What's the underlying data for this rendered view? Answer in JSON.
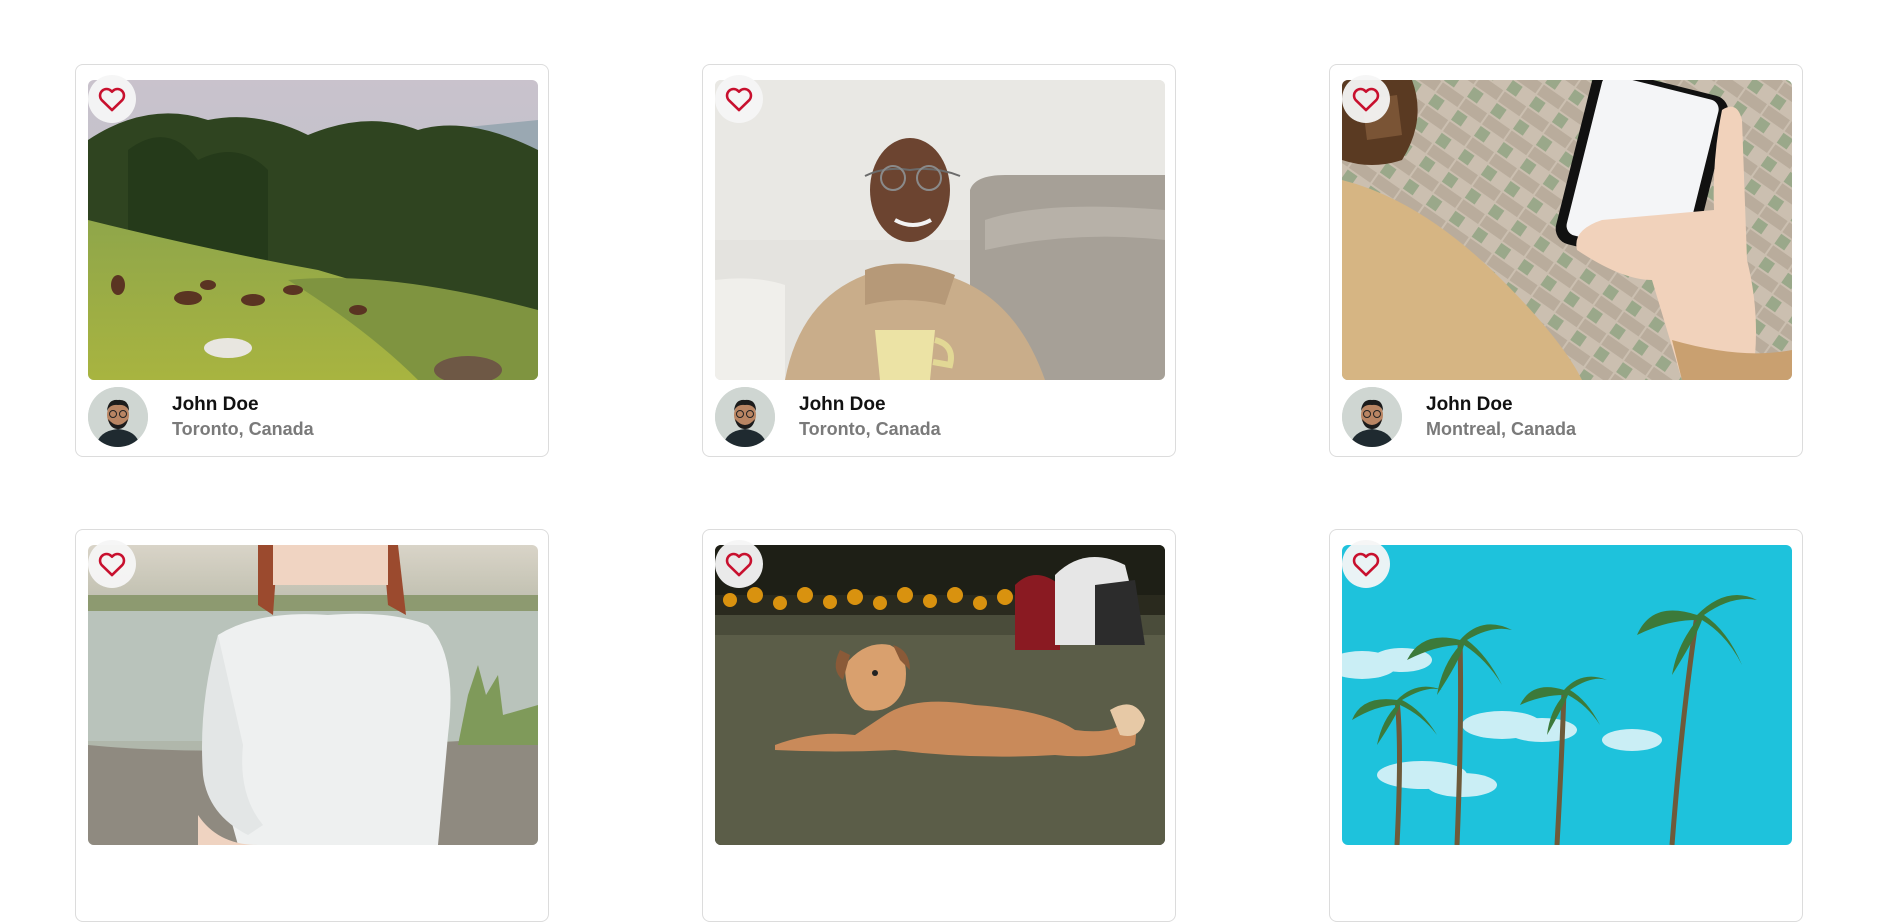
{
  "accent_color": "#c8102e",
  "cards": [
    {
      "author": "John Doe",
      "location": "Toronto, Canada",
      "photo": "horses-grazing-hillside",
      "like_icon": "heart-outline-icon"
    },
    {
      "author": "John Doe",
      "location": "Toronto, Canada",
      "photo": "smiling-man-with-mug",
      "like_icon": "heart-outline-icon"
    },
    {
      "author": "John Doe",
      "location": "Montreal, Canada",
      "photo": "hand-holding-phone",
      "like_icon": "heart-outline-icon"
    },
    {
      "author": "",
      "location": "",
      "photo": "woman-white-top-by-water",
      "like_icon": "heart-outline-icon"
    },
    {
      "author": "",
      "location": "",
      "photo": "dog-lying-on-grass",
      "like_icon": "heart-outline-icon"
    },
    {
      "author": "",
      "location": "",
      "photo": "palm-trees-blue-sky",
      "like_icon": "heart-outline-icon"
    }
  ]
}
